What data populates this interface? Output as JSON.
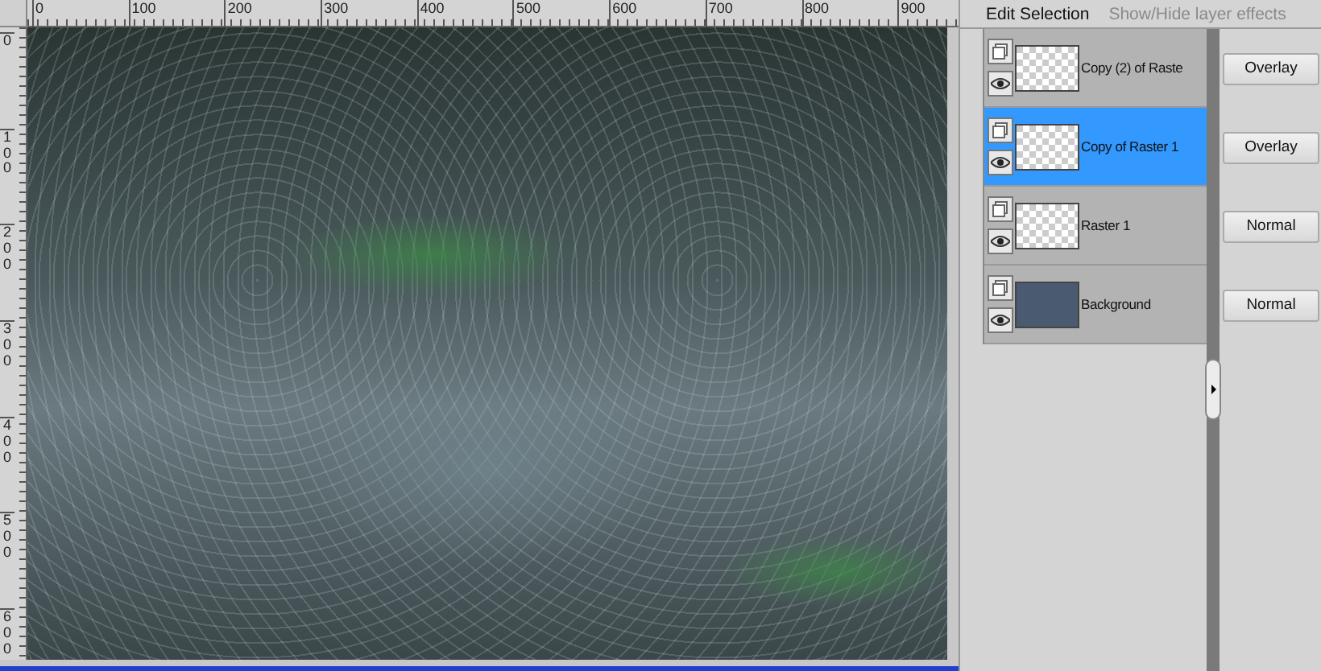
{
  "top_ruler": {
    "labels": [
      "0",
      "100",
      "200",
      "300",
      "400",
      "500",
      "600",
      "700",
      "800",
      "900"
    ]
  },
  "left_ruler": {
    "labels": [
      "0",
      "100",
      "200",
      "300",
      "400",
      "500",
      "600"
    ]
  },
  "layers_panel": {
    "tabs": [
      {
        "label": "Edit Selection",
        "disabled": false
      },
      {
        "label": "Show/Hide layer effects",
        "disabled": true
      }
    ],
    "layers": [
      {
        "name": "Copy (2) of Raste",
        "selected": false,
        "kind": "transparent",
        "blend": "Overlay"
      },
      {
        "name": "Copy of Raster 1",
        "selected": true,
        "kind": "transparent",
        "blend": "Overlay"
      },
      {
        "name": "Raster 1",
        "selected": false,
        "kind": "transparent",
        "blend": "Normal"
      },
      {
        "name": "Background",
        "selected": false,
        "kind": "solid",
        "blend": "Normal"
      }
    ]
  }
}
